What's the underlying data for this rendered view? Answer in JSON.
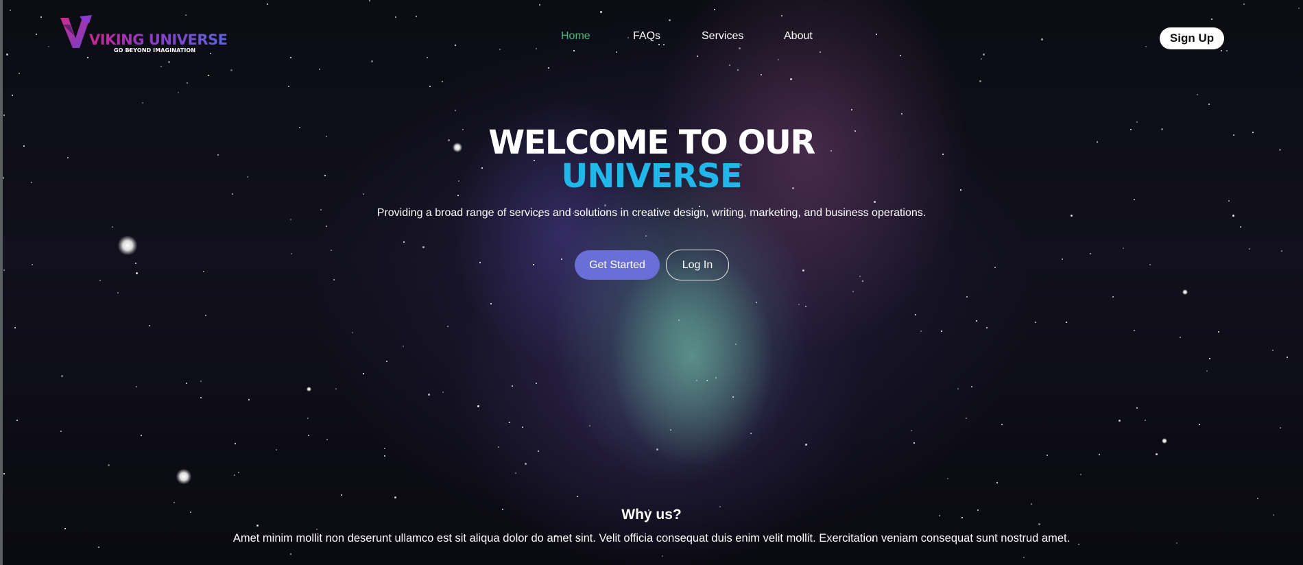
{
  "brand": {
    "name": "VIKING UNIVERSE",
    "tagline": "GO BEYOND IMAGINATION"
  },
  "nav": {
    "items": [
      {
        "label": "Home",
        "active": true
      },
      {
        "label": "FAQs",
        "active": false
      },
      {
        "label": "Services",
        "active": false
      },
      {
        "label": "About",
        "active": false
      }
    ],
    "signup_label": "Sign Up"
  },
  "hero": {
    "title_line1": "WELCOME TO OUR",
    "title_line2": "UNIVERSE",
    "subtitle": "Providing a broad range of services and solutions in creative design, writing, marketing, and business operations.",
    "primary_button": "Get Started",
    "secondary_button": "Log In"
  },
  "why_us": {
    "title": "Why us?",
    "text": "Amet minim mollit non deserunt ullamco est sit aliqua dolor do amet sint. Velit officia consequat duis enim velit mollit. Exercitation veniam consequat sunt nostrud amet."
  },
  "colors": {
    "active_nav": "#3ec07a",
    "accent_title": "#22b7ea",
    "primary_button": "#6a6fd8",
    "logo_gradient_start": "#c4288f",
    "logo_gradient_end": "#5b63d6"
  }
}
